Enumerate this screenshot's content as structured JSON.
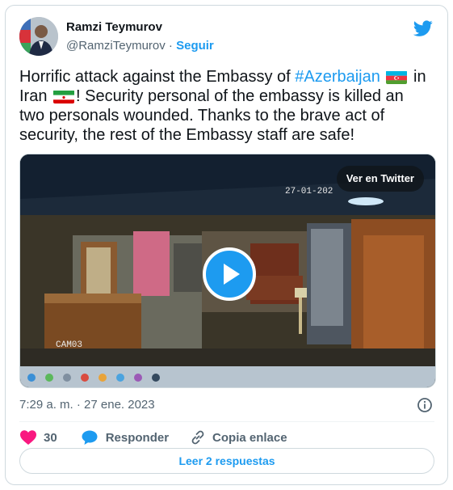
{
  "author": {
    "name": "Ramzi Teymurov",
    "handle": "@RamziTeymurov",
    "separator": "·",
    "follow_label": "Seguir"
  },
  "tweet": {
    "text_1": "Horrific attack against the Embassy of ",
    "hashtag": "#Azerbaijan",
    "text_2": " in Iran ",
    "text_3": "! Security personal of the embassy is killed an two personals wounded. Thanks to the brave act of security, the rest of the Embassy staff are safe!"
  },
  "media": {
    "view_on_twitter_label": "Ver en Twitter",
    "camera_date": "27-01-202",
    "camera_label": "CAM03"
  },
  "timestamp": "7:29 a. m. · 27 ene. 2023",
  "actions": {
    "like_count": "30",
    "reply_label": "Responder",
    "copy_link_label": "Copia enlace"
  },
  "read_replies_label": "Leer 2 respuestas",
  "colors": {
    "accent": "#1d9bf0",
    "like": "#f91880",
    "text": "#0f1419",
    "muted": "#536471",
    "border": "#cfd9de"
  },
  "icons": [
    "twitter-bird-icon",
    "play-icon",
    "info-icon",
    "heart-icon",
    "reply-bubble-icon",
    "link-icon",
    "azerbaijan-flag-icon",
    "iran-flag-icon"
  ]
}
